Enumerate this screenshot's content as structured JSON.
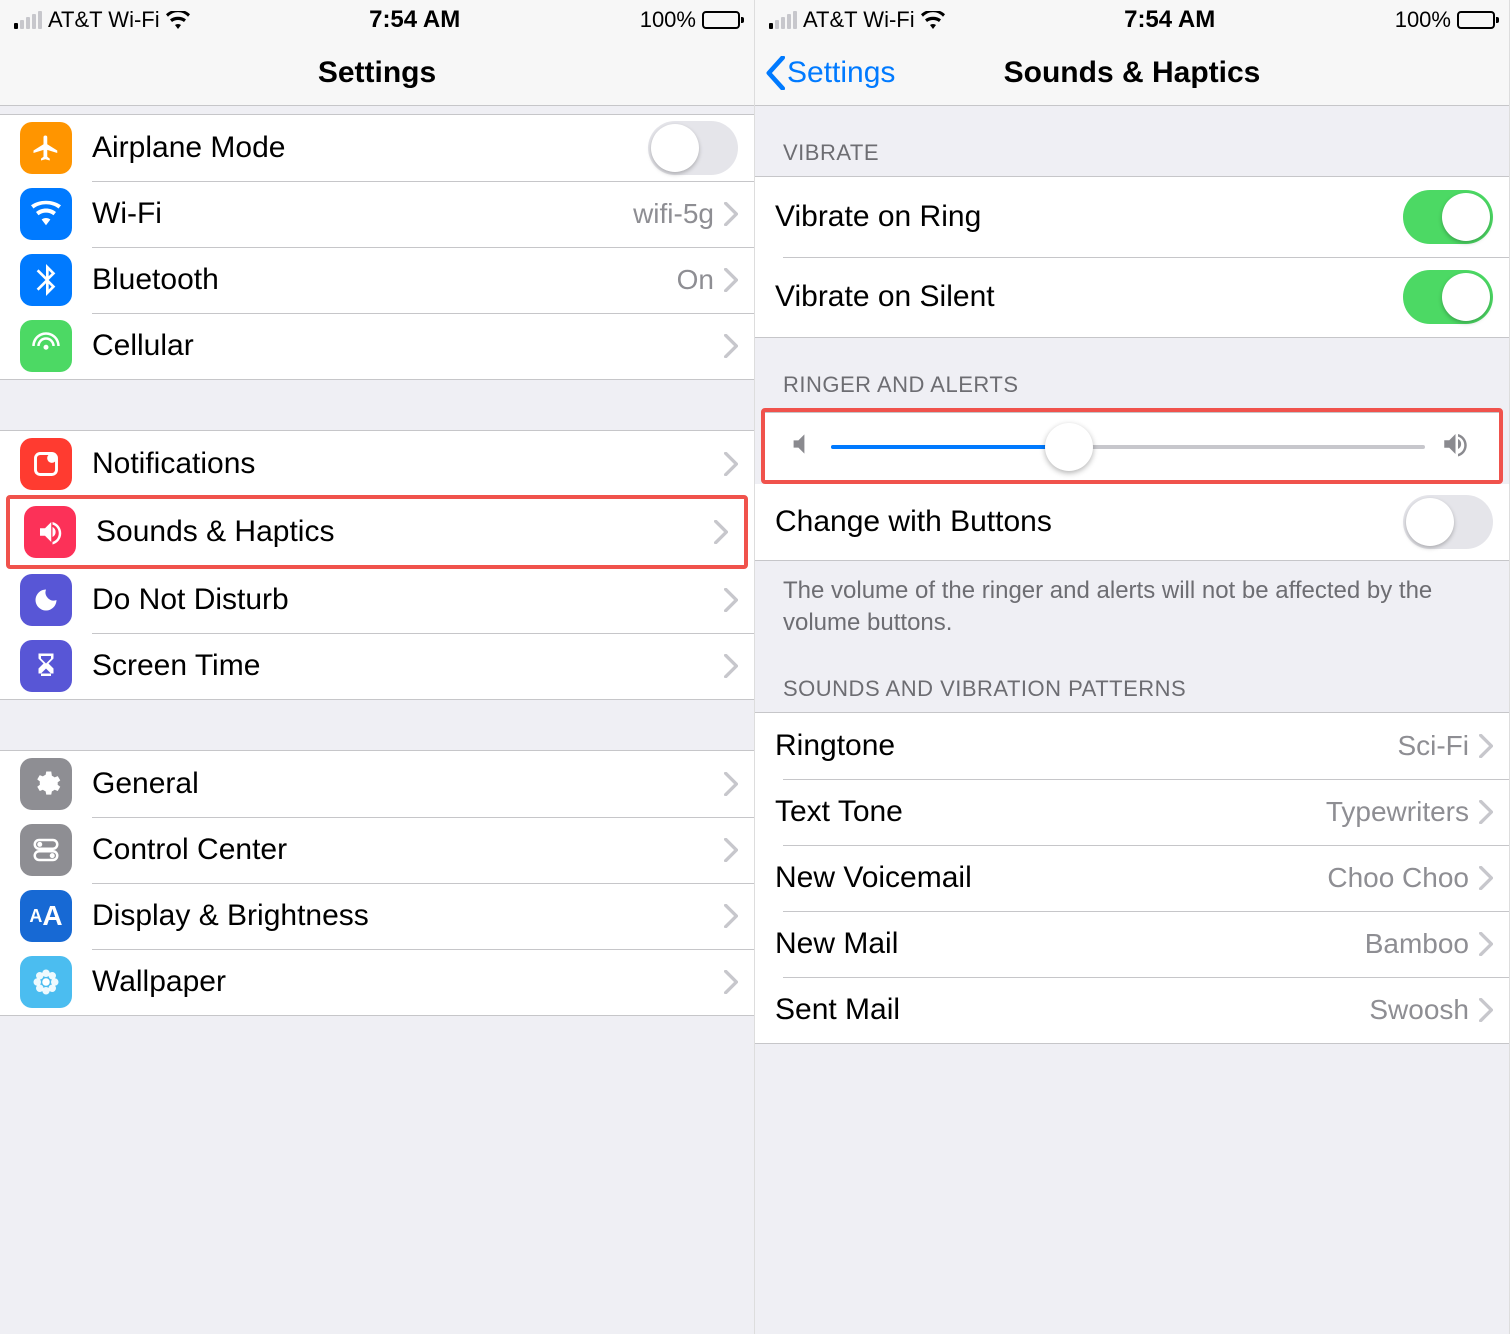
{
  "status": {
    "carrier": "AT&T Wi-Fi",
    "time": "7:54 AM",
    "battery": "100%"
  },
  "left": {
    "title": "Settings",
    "rows": {
      "airplane": "Airplane Mode",
      "wifi": "Wi-Fi",
      "wifi_detail": "wifi-5g",
      "bluetooth": "Bluetooth",
      "bluetooth_detail": "On",
      "cellular": "Cellular",
      "notifications": "Notifications",
      "sounds": "Sounds & Haptics",
      "dnd": "Do Not Disturb",
      "screentime": "Screen Time",
      "general": "General",
      "controlcenter": "Control Center",
      "display": "Display & Brightness",
      "wallpaper": "Wallpaper"
    }
  },
  "right": {
    "back": "Settings",
    "title": "Sounds & Haptics",
    "headers": {
      "vibrate": "VIBRATE",
      "ringer": "RINGER AND ALERTS",
      "patterns": "SOUNDS AND VIBRATION PATTERNS"
    },
    "rows": {
      "vibrate_ring": "Vibrate on Ring",
      "vibrate_silent": "Vibrate on Silent",
      "change_buttons": "Change with Buttons",
      "ringtone": "Ringtone",
      "ringtone_val": "Sci-Fi",
      "texttone": "Text Tone",
      "texttone_val": "Typewriters",
      "voicemail": "New Voicemail",
      "voicemail_val": "Choo Choo",
      "newmail": "New Mail",
      "newmail_val": "Bamboo",
      "sentmail": "Sent Mail",
      "sentmail_val": "Swoosh"
    },
    "footer": "The volume of the ringer and alerts will not be affected by the volume buttons.",
    "slider_percent": 40
  }
}
